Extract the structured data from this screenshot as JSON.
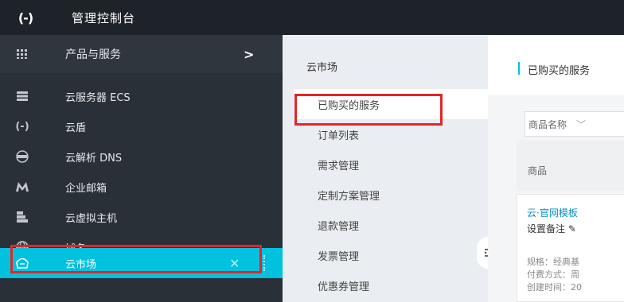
{
  "topbar": {
    "title": "管理控制台"
  },
  "sidebar": {
    "header": {
      "label": "产品与服务",
      "arrow": ">"
    },
    "items": [
      {
        "label": "云服务器 ECS",
        "icon": "server-icon"
      },
      {
        "label": "云盾",
        "icon": "shield-bracket-icon"
      },
      {
        "label": "云解析 DNS",
        "icon": "dns-icon"
      },
      {
        "label": "企业邮箱",
        "icon": "mail-m-icon"
      },
      {
        "label": "云虚拟主机",
        "icon": "host-icon"
      },
      {
        "label": "域名",
        "icon": "globe-icon"
      },
      {
        "label": "云市场",
        "icon": "market-icon"
      }
    ]
  },
  "subnav": {
    "title": "云市场",
    "items": [
      "已购买的服务",
      "订单列表",
      "需求管理",
      "定制方案管理",
      "退款管理",
      "发票管理",
      "优惠券管理"
    ]
  },
  "main": {
    "page_title": "已购买的服务",
    "filter_label": "商品名称",
    "column_header": "商品",
    "card": {
      "name": "云·官网模板",
      "note": "设置备注",
      "meta": [
        "规格：经典基",
        "付费方式：周",
        "创建时间：20"
      ]
    }
  },
  "colors": {
    "accent": "#00c1de",
    "highlight_box": "#e22626",
    "topbar": "#1e2329",
    "sidebar": "#293038"
  }
}
